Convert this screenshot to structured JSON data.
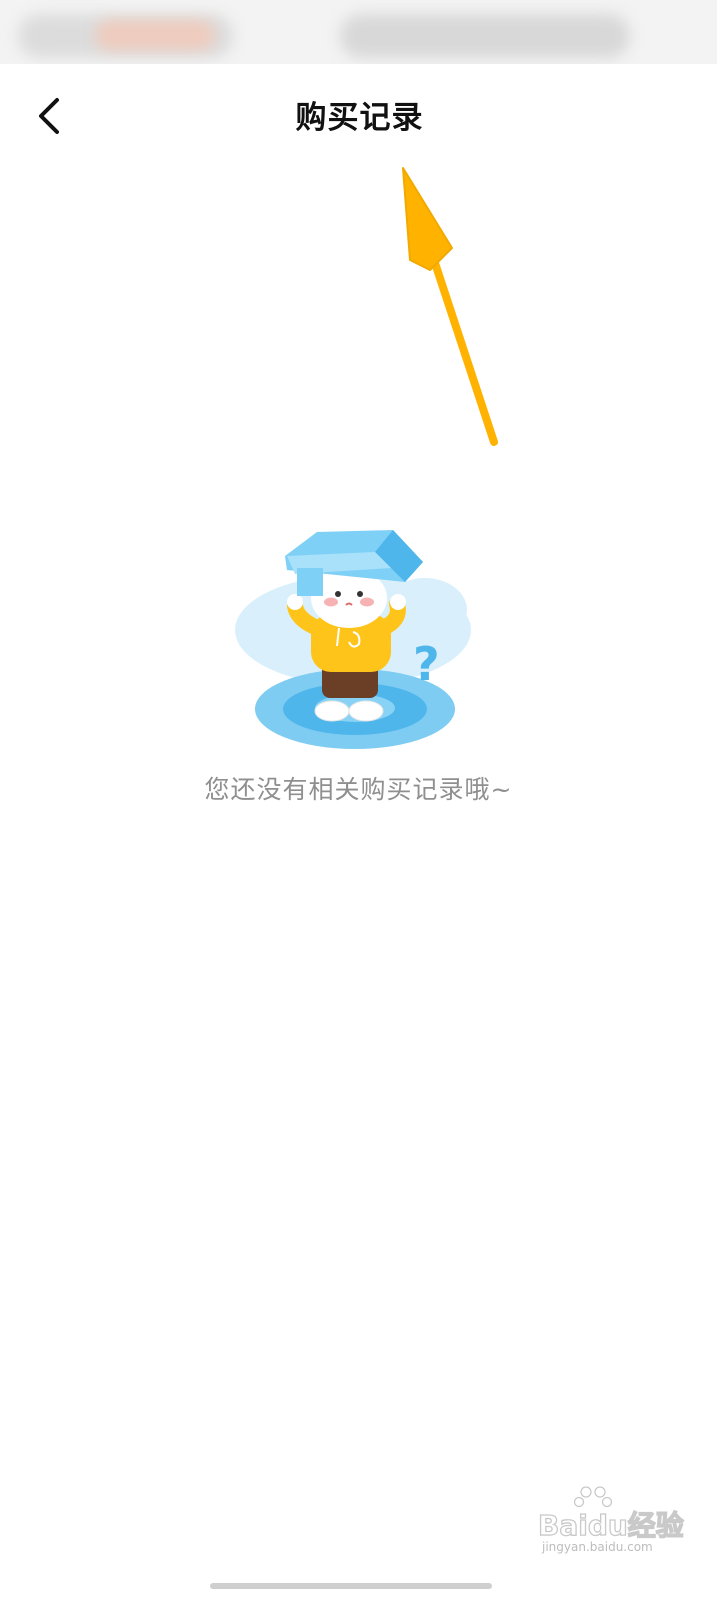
{
  "header": {
    "title": "购买记录",
    "back_icon": "chevron-left-icon"
  },
  "empty_state": {
    "illustration": "character-with-box-on-head-illustration",
    "message": "您还没有相关购买记录哦~"
  },
  "annotation": {
    "icon": "arrow-pointing-to-title",
    "color": "#FFB300"
  },
  "watermark": {
    "logo_text": "Baidu经验",
    "url": "jingyan.baidu.com"
  }
}
